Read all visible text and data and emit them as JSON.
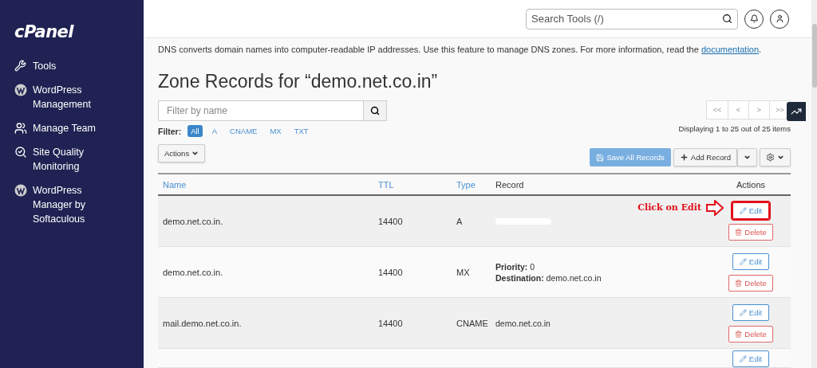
{
  "sidebar": {
    "logo": "cPanel",
    "items": [
      {
        "label": "Tools"
      },
      {
        "label": "WordPress Management"
      },
      {
        "label": "Manage Team"
      },
      {
        "label": "Site Quality Monitoring"
      },
      {
        "label": "WordPress Manager by Softaculous"
      }
    ]
  },
  "header": {
    "search": {
      "placeholder": "Search Tools (/)"
    }
  },
  "intro": {
    "text": "DNS converts domain names into computer-readable IP addresses. Use this feature to manage DNS zones. For more information, read the ",
    "link": "documentation",
    "end": "."
  },
  "title": "Zone Records for “demo.net.co.in”",
  "filter_search": {
    "placeholder": "Filter by name"
  },
  "filter": {
    "label": "Filter:",
    "options": [
      {
        "label": "All",
        "selected": true
      },
      {
        "label": "A",
        "selected": false
      },
      {
        "label": "CNAME",
        "selected": false
      },
      {
        "label": "MX",
        "selected": false
      },
      {
        "label": "TXT",
        "selected": false
      }
    ]
  },
  "pagination": {
    "buttons": [
      "<<",
      "<",
      ">",
      ">>"
    ],
    "summary": "Displaying 1 to 25 out of 25 items"
  },
  "toolbar": {
    "actions": "Actions",
    "save": "Save All Records",
    "add": "Add Record"
  },
  "table": {
    "columns": [
      "Name",
      "TTL",
      "Type",
      "Record",
      "Actions"
    ],
    "rows": [
      {
        "name": "demo.net.co.in.",
        "ttl": "14400",
        "type": "A",
        "record": [],
        "redacted": true,
        "annotation": "Click on Edit",
        "edit": "Edit",
        "delete": "Delete"
      },
      {
        "name": "demo.net.co.in.",
        "ttl": "14400",
        "type": "MX",
        "record": [
          "**Priority:** 0",
          "**Destination:** demo.net.co.in"
        ],
        "redacted": false,
        "edit": "Edit",
        "delete": "Delete"
      },
      {
        "name": "mail.demo.net.co.in.",
        "ttl": "14400",
        "type": "CNAME",
        "record": [
          "demo.net.co.in"
        ],
        "redacted": false,
        "edit": "Edit",
        "delete": "Delete"
      },
      {
        "name": "",
        "ttl": "",
        "type": "",
        "record": [],
        "redacted": false,
        "edit": "Edit"
      }
    ]
  }
}
